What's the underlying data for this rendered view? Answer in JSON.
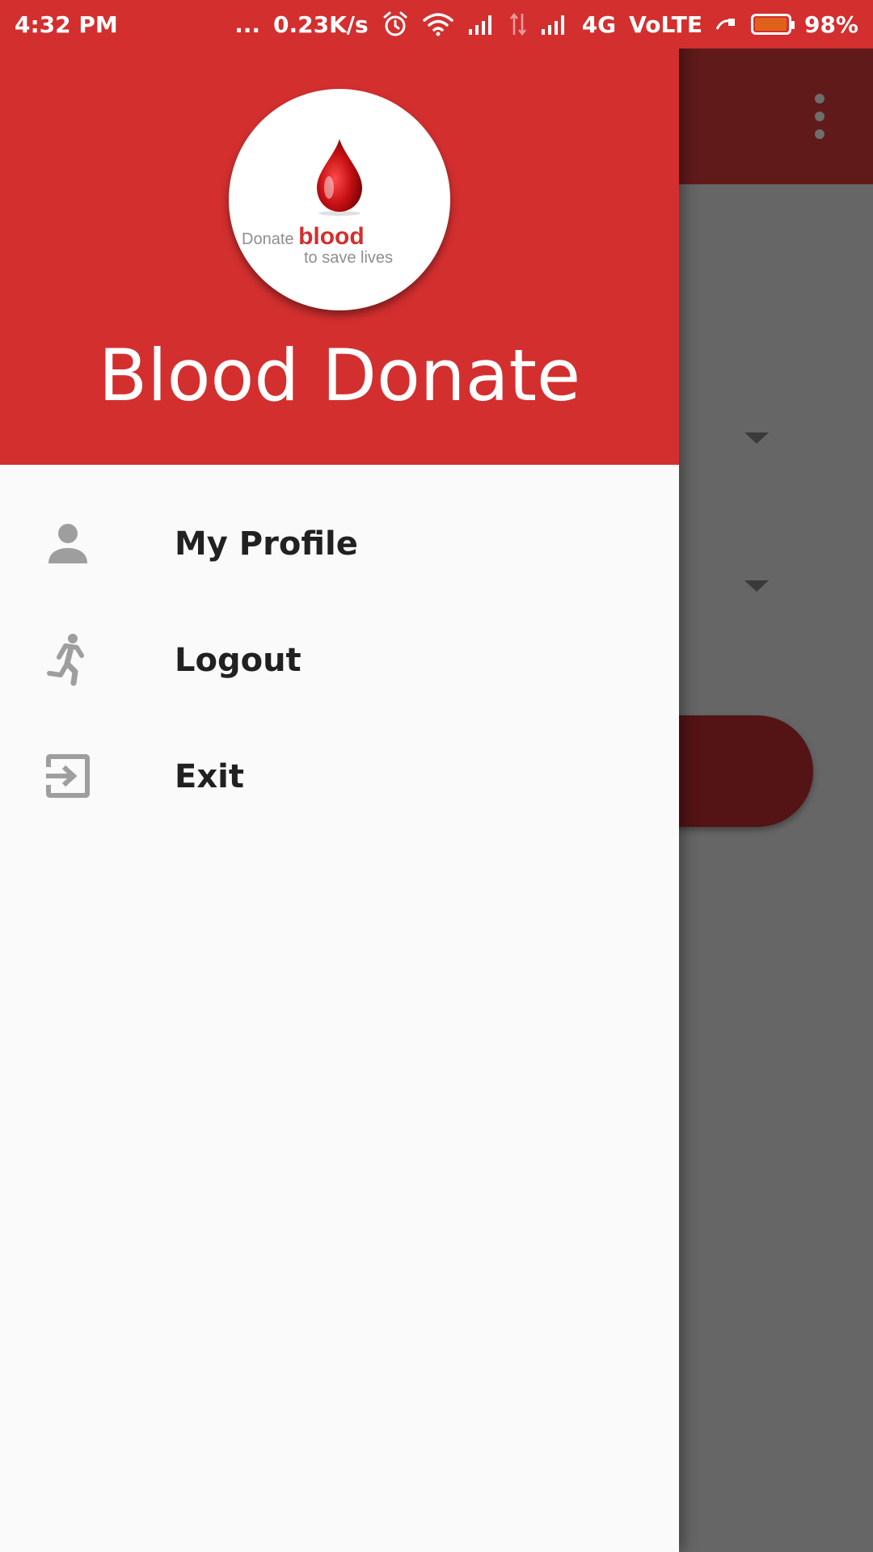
{
  "status_bar": {
    "time": "4:32 PM",
    "dots": "...",
    "network_speed": "0.23K/s",
    "network_type": "4G",
    "volte": "VoLTE",
    "battery_percent": "98%",
    "battery_level": 0.98,
    "battery_color": "#e0611c"
  },
  "drawer": {
    "header": {
      "logo": {
        "line1_prefix": "Donate",
        "line1_emphasis": "blood",
        "line2": "to save lives"
      },
      "title": "Blood Donate"
    },
    "items": [
      {
        "label": "My Profile",
        "icon": "person-icon"
      },
      {
        "label": "Logout",
        "icon": "running-person-icon"
      },
      {
        "label": "Exit",
        "icon": "exit-icon"
      }
    ]
  },
  "colors": {
    "primary": "#d32f2f",
    "dimmed_toolbar": "#601a1a",
    "dimmed_button": "#541315",
    "icon_gray": "#9e9e9e",
    "menu_text": "#212121"
  }
}
